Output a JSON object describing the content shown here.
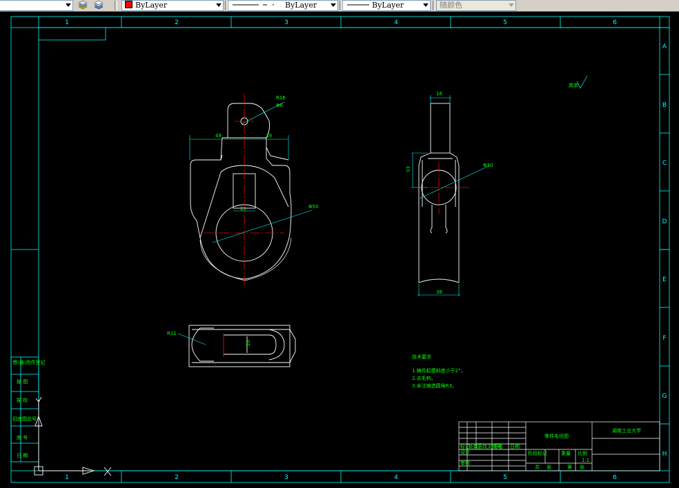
{
  "toolbar": {
    "layer_dropdown": "",
    "color": {
      "label": "ByLayer",
      "swatch": "#ff0000"
    },
    "linetype": {
      "label": "ByLayer",
      "pattern": "— —  -"
    },
    "lineweight": {
      "label": "ByLayer"
    },
    "plotstyle": {
      "label": "随颜色"
    }
  },
  "drawing": {
    "colors": {
      "background": "#000000",
      "frame": "#00ffff",
      "geometry": "#ffffff",
      "centerline": "#ff0000",
      "dimension": "#00ff00",
      "leader": "#00ffff"
    },
    "zone_columns": [
      "1",
      "2",
      "3",
      "4",
      "5",
      "6"
    ],
    "zone_rows": [
      "A",
      "B",
      "C",
      "D",
      "E",
      "F",
      "G",
      "H"
    ],
    "dims": {
      "r16": "R16",
      "phi6": "Φ6",
      "d49": "49",
      "d39": "39",
      "d20": "20",
      "phi50": "Φ50",
      "d16": "16",
      "d33": "33",
      "phi30": "Φ30",
      "d38": "38",
      "r11": "R11",
      "d20b": "20"
    },
    "roughness": "其余",
    "tech_requirements": {
      "title": "技术要求",
      "items": [
        "1.铸件起模斜度小于2°。",
        "2.去毛刺。",
        "3.未注铸造圆角R3。"
      ]
    },
    "title_block": {
      "part_name": "零件毛坯图",
      "school": "湖南工业大学",
      "scale": "1:1",
      "labels": [
        "标记",
        "处数",
        "更改文件号",
        "签名",
        "日期",
        "设计",
        "审核",
        "阶段标记",
        "重量",
        "比例",
        "共",
        "张",
        "第",
        "张"
      ]
    },
    "left_column_labels": [
      "借(通)用件登记",
      "描  图",
      "描  校",
      "旧底图总号",
      "底  号",
      "日  期"
    ]
  }
}
